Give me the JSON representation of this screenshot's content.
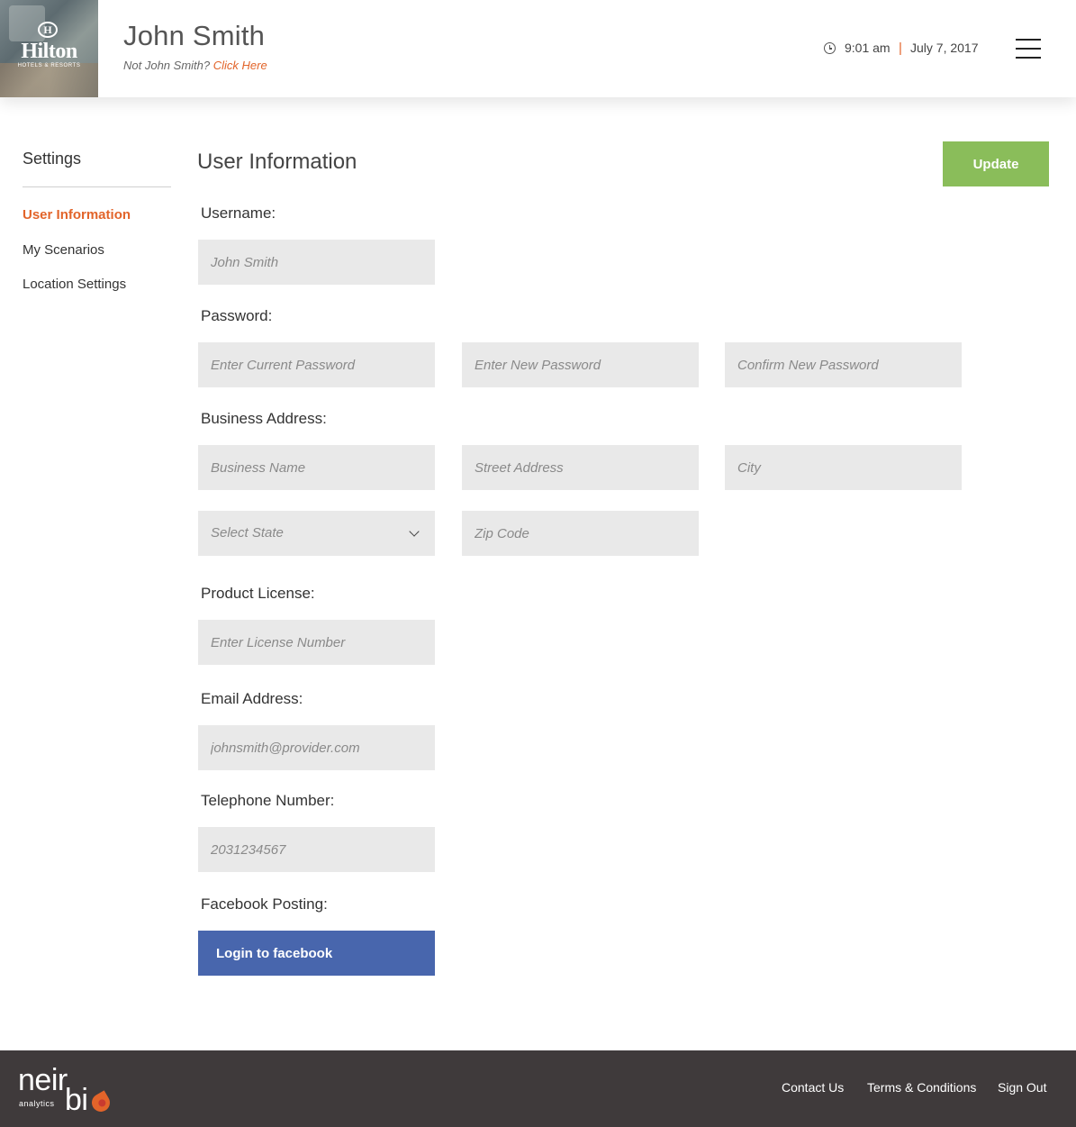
{
  "header": {
    "logo_text": "Hilton",
    "logo_subtext": "HOTELS & RESORTS",
    "user_name": "John Smith",
    "not_user_text": "Not John Smith?",
    "not_user_link": "Click Here",
    "time": "9:01 am",
    "separator": "|",
    "date": "July 7, 2017",
    "menu_icon": "hamburger-menu-icon",
    "accent_color": "#e2642a"
  },
  "sidebar": {
    "title": "Settings",
    "items": [
      {
        "label": "User Information",
        "active": true
      },
      {
        "label": "My Scenarios",
        "active": false
      },
      {
        "label": "Location Settings",
        "active": false
      }
    ]
  },
  "main": {
    "title": "User Information",
    "update_label": "Update",
    "update_color": "#8abd5a",
    "username": {
      "label": "Username:",
      "placeholder": "John Smith"
    },
    "password": {
      "label": "Password:",
      "current_placeholder": "Enter Current Password",
      "new_placeholder": "Enter New Password",
      "confirm_placeholder": "Confirm New Password"
    },
    "business_address": {
      "label": "Business Address:",
      "name_placeholder": "Business Name",
      "street_placeholder": "Street Address",
      "city_placeholder": "City",
      "state_select": "Select State",
      "zip_placeholder": "Zip Code"
    },
    "product_license": {
      "label": "Product License:",
      "placeholder": "Enter License Number"
    },
    "email": {
      "label": "Email Address:",
      "placeholder": "johnsmith@provider.com"
    },
    "telephone": {
      "label": "Telephone Number:",
      "placeholder": "2031234567"
    },
    "facebook": {
      "label": "Facebook Posting:",
      "button_label": "Login to facebook",
      "button_color": "#4866ad"
    }
  },
  "footer": {
    "brand_neir": "neir",
    "brand_bi": "bi",
    "brand_analytics": "analytics",
    "links": [
      "Contact Us",
      "Terms & Conditions",
      "Sign Out"
    ],
    "background": "#3f3a3b"
  }
}
